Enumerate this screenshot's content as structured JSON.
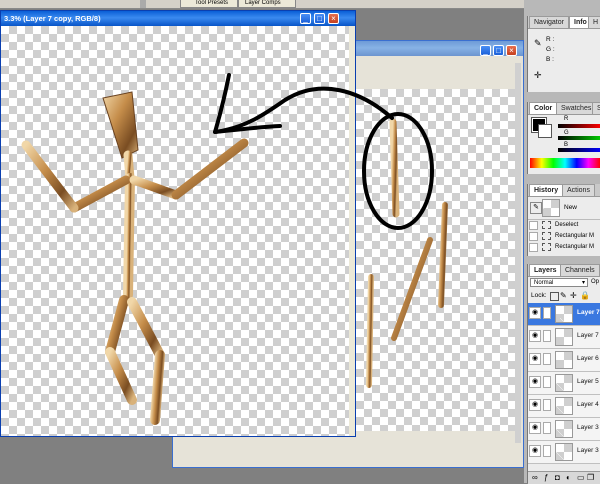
{
  "top_bar": {
    "tabs": [
      "Tool Presets",
      "Layer Comps"
    ]
  },
  "document_front": {
    "title": "3.3% (Layer 7 copy, RGB/8)"
  },
  "document_back": {},
  "navigator_panel": {
    "tabs": [
      "Navigator",
      "Info",
      "H"
    ],
    "info_labels": [
      "R :",
      "G :",
      "B :"
    ]
  },
  "color_panel": {
    "tabs": [
      "Color",
      "Swatches",
      "S"
    ],
    "slider_labels": [
      "R",
      "G",
      "B"
    ]
  },
  "history_panel": {
    "tabs": [
      "History",
      "Actions"
    ],
    "snapshot_label": "New",
    "items": [
      "Deselect",
      "Rectangular M",
      "Rectangular M"
    ]
  },
  "layers_panel": {
    "tabs": [
      "Layers",
      "Channels"
    ],
    "blend_mode": "Normal",
    "opacity_label": "Op",
    "lock_label": "Lock:",
    "layers": [
      {
        "name": "Layer 7",
        "selected": true
      },
      {
        "name": "Layer 7",
        "selected": false
      },
      {
        "name": "Layer 6",
        "selected": false
      },
      {
        "name": "Layer 5",
        "selected": false
      },
      {
        "name": "Layer 4",
        "selected": false
      },
      {
        "name": "Layer 3",
        "selected": false
      },
      {
        "name": "Layer 3",
        "selected": false
      }
    ]
  },
  "colors": {
    "titlebar": "#0a5fd6",
    "selection": "#3a78e0",
    "wood": "#c08a4a"
  }
}
